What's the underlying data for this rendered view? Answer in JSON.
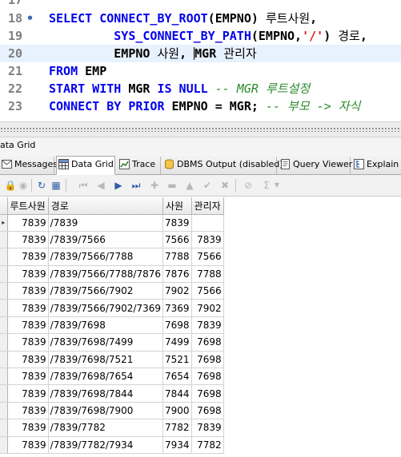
{
  "editor": {
    "lines": [
      {
        "n": "17",
        "tokens": []
      },
      {
        "n": "18",
        "marker": "•",
        "tokens": [
          {
            "c": "kw",
            "t": "SELECT "
          },
          {
            "c": "kw",
            "t": "CONNECT_BY_ROOT"
          },
          {
            "c": "id",
            "t": "(EMPNO) "
          },
          {
            "c": "kr",
            "t": "루트사원"
          },
          {
            "c": "id",
            "t": ","
          }
        ]
      },
      {
        "n": "19",
        "tokens": [
          {
            "c": "id",
            "t": "         "
          },
          {
            "c": "kw",
            "t": "SYS_CONNECT_BY_PATH"
          },
          {
            "c": "id",
            "t": "(EMPNO,"
          },
          {
            "c": "str",
            "t": "'/'"
          },
          {
            "c": "id",
            "t": ") "
          },
          {
            "c": "kr",
            "t": "경로"
          },
          {
            "c": "id",
            "t": ","
          }
        ]
      },
      {
        "n": "20",
        "current": true,
        "tokens": [
          {
            "c": "id",
            "t": "         EMPNO "
          },
          {
            "c": "kr",
            "t": "사원"
          },
          {
            "c": "id",
            "t": ", "
          },
          {
            "c": "caret",
            "t": ""
          },
          {
            "c": "id",
            "t": "MGR "
          },
          {
            "c": "kr",
            "t": "관리자"
          }
        ]
      },
      {
        "n": "21",
        "tokens": [
          {
            "c": "kw",
            "t": "FROM "
          },
          {
            "c": "id",
            "t": "EMP"
          }
        ]
      },
      {
        "n": "22",
        "tokens": [
          {
            "c": "kw",
            "t": "START WITH "
          },
          {
            "c": "id",
            "t": "MGR "
          },
          {
            "c": "kw",
            "t": "IS NULL "
          },
          {
            "c": "cmt",
            "t": "-- MGR 루트설정"
          }
        ]
      },
      {
        "n": "23",
        "tokens": [
          {
            "c": "kw",
            "t": "CONNECT BY PRIOR "
          },
          {
            "c": "id",
            "t": "EMPNO = MGR; "
          },
          {
            "c": "cmt",
            "t": "-- 부모 -> 자식"
          }
        ]
      }
    ]
  },
  "panel": {
    "title": "ata Grid"
  },
  "tabs": [
    {
      "label": "Messages",
      "icon": "messages-icon"
    },
    {
      "label": "Data Grid",
      "icon": "data-grid-icon",
      "active": true
    },
    {
      "label": "Trace",
      "icon": "trace-icon"
    },
    {
      "label": "DBMS Output (disabled)",
      "icon": "dbms-output-icon"
    },
    {
      "label": "Query Viewer",
      "icon": "query-viewer-icon"
    },
    {
      "label": "Explain",
      "icon": "explain-icon"
    }
  ],
  "grid": {
    "columns": [
      "루트사원",
      "경로",
      "사원",
      "관리자"
    ],
    "rows": [
      [
        "7839",
        "/7839",
        "7839",
        ""
      ],
      [
        "7839",
        "/7839/7566",
        "7566",
        "7839"
      ],
      [
        "7839",
        "/7839/7566/7788",
        "7788",
        "7566"
      ],
      [
        "7839",
        "/7839/7566/7788/7876",
        "7876",
        "7788"
      ],
      [
        "7839",
        "/7839/7566/7902",
        "7902",
        "7566"
      ],
      [
        "7839",
        "/7839/7566/7902/7369",
        "7369",
        "7902"
      ],
      [
        "7839",
        "/7839/7698",
        "7698",
        "7839"
      ],
      [
        "7839",
        "/7839/7698/7499",
        "7499",
        "7698"
      ],
      [
        "7839",
        "/7839/7698/7521",
        "7521",
        "7698"
      ],
      [
        "7839",
        "/7839/7698/7654",
        "7654",
        "7698"
      ],
      [
        "7839",
        "/7839/7698/7844",
        "7844",
        "7698"
      ],
      [
        "7839",
        "/7839/7698/7900",
        "7900",
        "7698"
      ],
      [
        "7839",
        "/7839/7782",
        "7782",
        "7839"
      ],
      [
        "7839",
        "/7839/7782/7934",
        "7934",
        "7782"
      ]
    ],
    "current_row_marker": "▸"
  }
}
